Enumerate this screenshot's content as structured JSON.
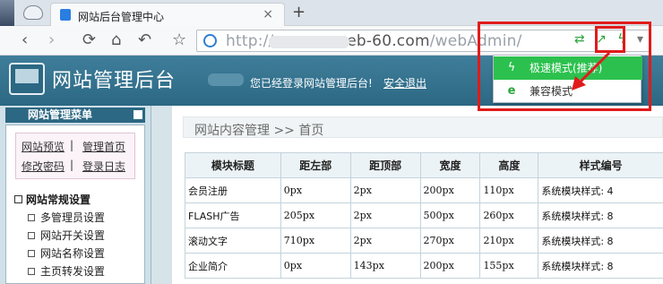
{
  "browser": {
    "tab_title": "网站后台管理中心",
    "tab_close": "×",
    "new_tab": "+",
    "nav": {
      "back": "‹",
      "forward": "›",
      "reload": "⟳",
      "home": "⌂",
      "undo": "↶",
      "bookmark": "☆"
    },
    "address": {
      "prefix": "http://",
      "host": ".web-60.com",
      "path": "/webAdmin/"
    },
    "mode_menu": {
      "items": [
        {
          "label": "极速模式(推荐)",
          "icon": "lightning-icon"
        },
        {
          "label": "兼容模式",
          "icon": "ie-icon"
        }
      ]
    },
    "colors": {
      "highlight": "#e01b1b",
      "fast_mode": "#2cc14e"
    }
  },
  "header": {
    "logo_text": "网站管理后台",
    "welcome": "您已经登录网站管理后台!",
    "logout": "安全退出",
    "color": "#2c6883"
  },
  "sidebar": {
    "title": "网站管理菜单",
    "quick_links": [
      "网站预览",
      "管理首页",
      "修改密码",
      "登录日志"
    ],
    "separator": "|",
    "group": "网站常规设置",
    "items": [
      "多管理员设置",
      "网站开关设置",
      "网站名称设置",
      "主页转发设置"
    ]
  },
  "main": {
    "breadcrumb": "网站内容管理 >> 首页",
    "columns": [
      "模块标题",
      "距左部",
      "距顶部",
      "宽度",
      "高度",
      "样式编号"
    ],
    "rows": [
      [
        "会员注册",
        "0px",
        "2px",
        "200px",
        "110px",
        "系统模块样式: 4"
      ],
      [
        "FLASH广告",
        "205px",
        "2px",
        "500px",
        "260px",
        "系统模块样式: 8"
      ],
      [
        "滚动文字",
        "710px",
        "2px",
        "270px",
        "210px",
        "系统模块样式: 8"
      ],
      [
        "企业简介",
        "0px",
        "143px",
        "200px",
        "155px",
        "系统模块样式: 8"
      ]
    ]
  }
}
